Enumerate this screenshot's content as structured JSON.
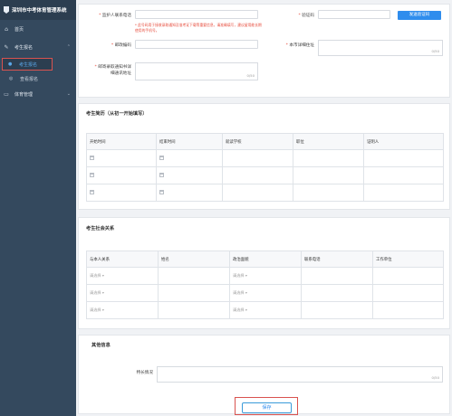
{
  "app": {
    "title": "深圳市中考体育管理系统"
  },
  "sidebar": {
    "items": [
      {
        "label": "首页",
        "icon": "home-icon"
      },
      {
        "label": "考生报名",
        "icon": "edit-icon",
        "expanded": true,
        "children": [
          {
            "label": "考生报名",
            "icon": "user-icon",
            "active": true
          },
          {
            "label": "查看报名",
            "icon": "view-icon",
            "active": false
          }
        ]
      },
      {
        "label": "体育管理",
        "icon": "folder-icon"
      }
    ]
  },
  "form": {
    "guardian_phone_label": "监护人联系电话",
    "guardian_phone_value": "",
    "verify_code_label": "验证码",
    "verify_code_value": "",
    "send_code_button": "发送验证码",
    "hint": "* 此号码用于接收录取通知及准考证下载等重要信息，请准确填写，建议留用能长期使用的手机号。",
    "postcode_label": "邮政编码",
    "postcode_value": "",
    "address_label": "本市详细住址",
    "address_counter": "0/50",
    "mail_address_label_1": "邮寄录取通知书详",
    "mail_address_label_2": "细通讯地址",
    "mail_address_counter": "0/50"
  },
  "resume": {
    "title": "考生简历（从初一开始填写）",
    "headers": [
      "开始时间",
      "结束时间",
      "就读学校",
      "职位",
      "证明人"
    ],
    "rows": 3
  },
  "social": {
    "title": "考生社会关系",
    "headers": [
      "与本人关系",
      "姓名",
      "政治面貌",
      "联系电话",
      "工作单位"
    ],
    "select_placeholder": "请选择",
    "rows": 3
  },
  "other": {
    "title": "其他信息",
    "special_label": "特长情况",
    "special_counter": "0/50"
  },
  "save_button": "保存",
  "colors": {
    "sidebar_bg": "#34495e",
    "accent": "#2f8ded",
    "highlight": "#d9534f"
  }
}
